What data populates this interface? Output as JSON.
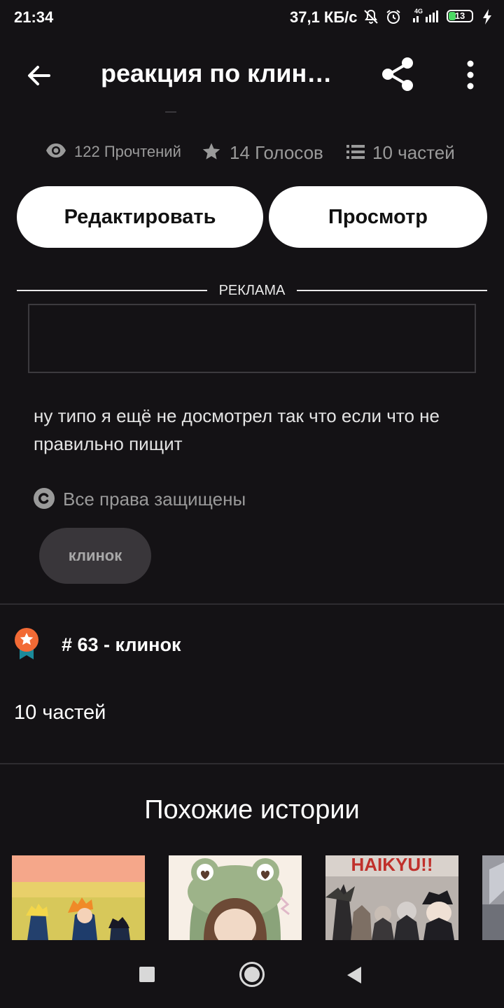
{
  "status_bar": {
    "time": "21:34",
    "network_speed": "37,1 КБ/с",
    "signal_label": "4G",
    "battery": "13",
    "icons": [
      "mute-bell-icon",
      "alarm-icon",
      "signal-icon",
      "battery-icon",
      "charging-icon"
    ]
  },
  "app_bar": {
    "title": "реакция по клин…",
    "icons": [
      "back-arrow-icon",
      "share-icon",
      "more-vert-icon"
    ]
  },
  "stats": {
    "reads": "122 Прочтений",
    "votes": "14 Голосов",
    "parts": "10 частей"
  },
  "actions": {
    "edit_label": "Редактировать",
    "view_label": "Просмотр"
  },
  "ad": {
    "label": "РЕКЛАМА"
  },
  "description": "ну типо я ещё не досмотрел так что если что не правильно пищит",
  "copyright": "Все права защищены",
  "tag": "клинок",
  "ranking": {
    "text": "# 63 - клинок"
  },
  "parts_summary": "10 частей",
  "similar": {
    "title": "Похожие истории",
    "cards": [
      {
        "name": "story-cover-1"
      },
      {
        "name": "story-cover-2"
      },
      {
        "name": "story-cover-3",
        "cover_text": "HAIKYU!!"
      },
      {
        "name": "story-cover-4"
      }
    ]
  },
  "colors": {
    "background": "#141215",
    "button_bg": "#ffffff",
    "muted_text": "#9a9a9a",
    "tag_bg": "#39363a",
    "rank_orange": "#f26a35",
    "rank_teal": "#1a8a9a"
  }
}
